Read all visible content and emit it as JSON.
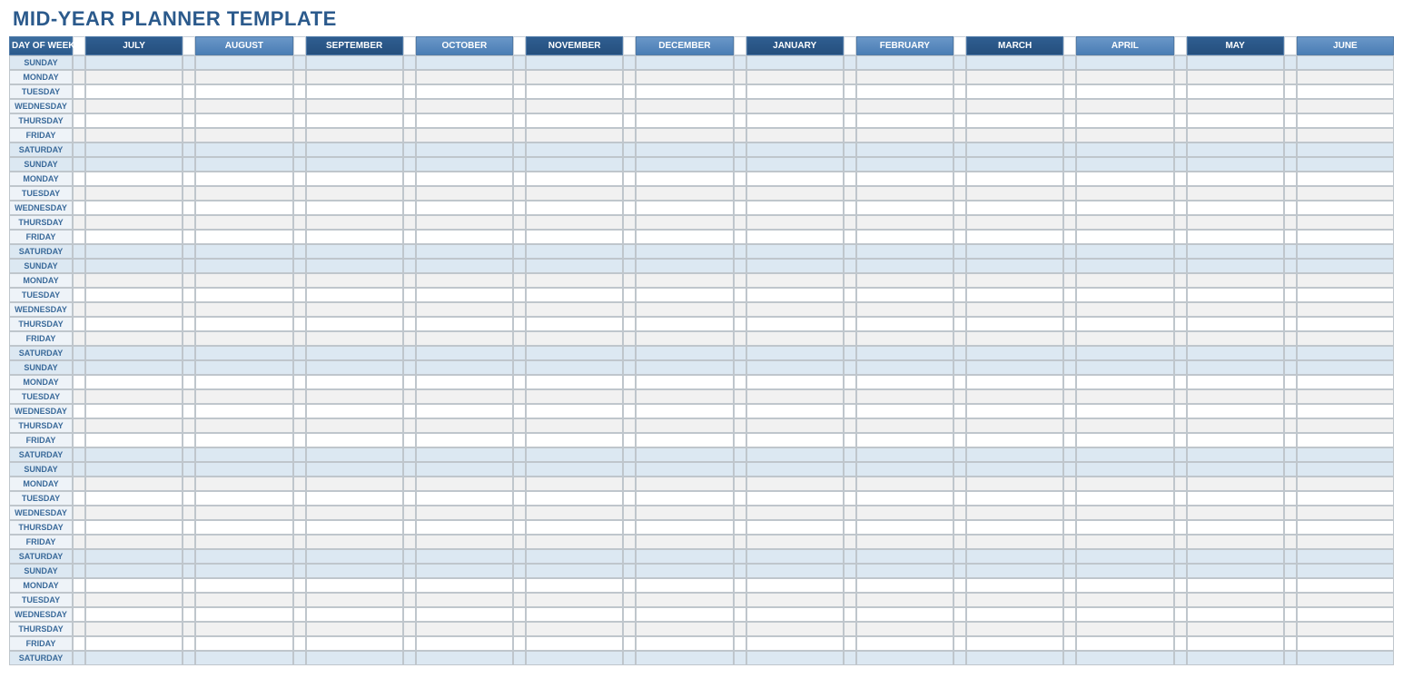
{
  "title": "MID-YEAR PLANNER TEMPLATE",
  "header": {
    "corner": "DAY OF WEEK",
    "months": [
      "JULY",
      "AUGUST",
      "SEPTEMBER",
      "OCTOBER",
      "NOVEMBER",
      "DECEMBER",
      "JANUARY",
      "FEBRUARY",
      "MARCH",
      "APRIL",
      "MAY",
      "JUNE"
    ]
  },
  "days_cycle": [
    "SUNDAY",
    "MONDAY",
    "TUESDAY",
    "WEDNESDAY",
    "THURSDAY",
    "FRIDAY",
    "SATURDAY"
  ],
  "weeks_shown": 6,
  "weekend_days": [
    "SATURDAY",
    "SUNDAY"
  ],
  "colors": {
    "title": "#2b5a8c",
    "header_dark": "#2b5a8c",
    "header_light": "#5a8bc0",
    "weekend_bg": "#dce8f2",
    "alt_bg": "#f1f1f1",
    "border": "#bfc6cc"
  }
}
